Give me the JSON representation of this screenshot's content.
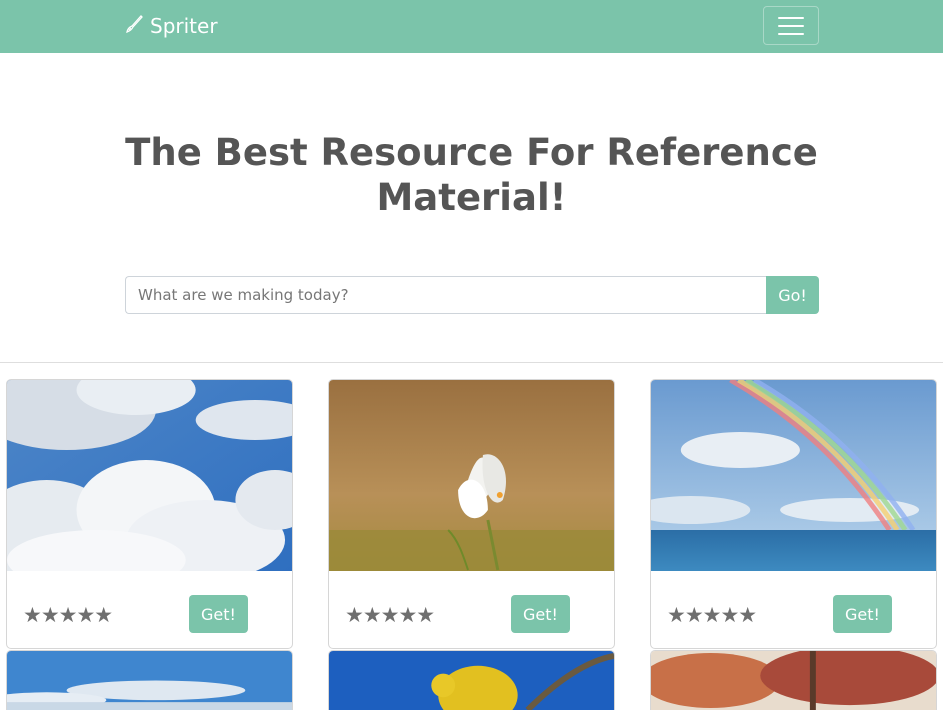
{
  "nav": {
    "brand": "Spriter",
    "brand_icon": "brush-icon",
    "menu_icon": "hamburger-icon"
  },
  "hero": {
    "title_line1": "The Best Resource For Reference",
    "title_line2": "Material!"
  },
  "search": {
    "placeholder": "What are we making today?",
    "button_label": "Go!"
  },
  "colors": {
    "accent": "#7bc4aa",
    "text": "#555555",
    "star": "#6f6f6f"
  },
  "cards": [
    {
      "image": "clouds-sky-image",
      "stars": "★★★★★",
      "button": "Get!"
    },
    {
      "image": "white-crocus-flower-image",
      "stars": "★★★★★",
      "button": "Get!"
    },
    {
      "image": "rainbow-over-sea-image",
      "stars": "★★★★★",
      "button": "Get!"
    }
  ],
  "partial_cards": [
    {
      "image": "blue-sky-horizon-image"
    },
    {
      "image": "yellow-bird-on-branch-image"
    },
    {
      "image": "autumn-tree-image"
    }
  ]
}
